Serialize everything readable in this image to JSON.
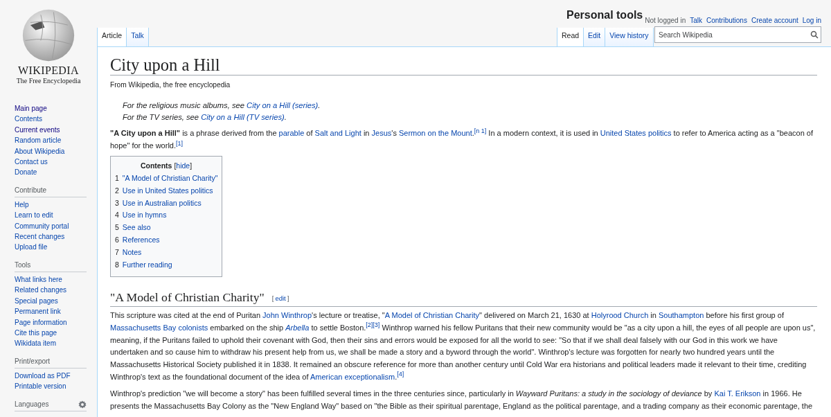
{
  "personal_tools": {
    "heading": "Personal tools",
    "items": [
      {
        "label": "Not logged in",
        "kind": "text"
      },
      {
        "label": "Talk",
        "kind": "link"
      },
      {
        "label": "Contributions",
        "kind": "link"
      },
      {
        "label": "Create account",
        "kind": "link"
      },
      {
        "label": "Log in",
        "kind": "link"
      }
    ]
  },
  "logo": {
    "wordmark": "WIKIPEDIA",
    "tagline": "The Free Encyclopedia"
  },
  "sidebar": {
    "navigation": [
      {
        "label": "Main page",
        "visited": true
      },
      {
        "label": "Contents",
        "visited": false
      },
      {
        "label": "Current events",
        "visited": true
      },
      {
        "label": "Random article",
        "visited": false
      },
      {
        "label": "About Wikipedia",
        "visited": false
      },
      {
        "label": "Contact us",
        "visited": false
      },
      {
        "label": "Donate",
        "visited": false
      }
    ],
    "portals": [
      {
        "heading": "Contribute",
        "items": [
          {
            "label": "Help",
            "visited": false
          },
          {
            "label": "Learn to edit",
            "visited": false
          },
          {
            "label": "Community portal",
            "visited": false
          },
          {
            "label": "Recent changes",
            "visited": false
          },
          {
            "label": "Upload file",
            "visited": false
          }
        ]
      },
      {
        "heading": "Tools",
        "items": [
          {
            "label": "What links here",
            "visited": false
          },
          {
            "label": "Related changes",
            "visited": false
          },
          {
            "label": "Special pages",
            "visited": false
          },
          {
            "label": "Permanent link",
            "visited": false
          },
          {
            "label": "Page information",
            "visited": false
          },
          {
            "label": "Cite this page",
            "visited": false
          },
          {
            "label": "Wikidata item",
            "visited": false
          }
        ]
      },
      {
        "heading": "Print/export",
        "items": [
          {
            "label": "Download as PDF",
            "visited": false
          },
          {
            "label": "Printable version",
            "visited": false
          }
        ]
      },
      {
        "heading": "Languages",
        "kind": "languages"
      }
    ]
  },
  "left_tabs": [
    {
      "label": "Article",
      "selected": true
    },
    {
      "label": "Talk",
      "selected": false
    }
  ],
  "right_tabs": [
    {
      "label": "Read",
      "selected": true
    },
    {
      "label": "Edit",
      "selected": false
    },
    {
      "label": "View history",
      "selected": false
    }
  ],
  "search": {
    "placeholder": "Search Wikipedia"
  },
  "article": {
    "title": "City upon a Hill",
    "subtitle": "From Wikipedia, the free encyclopedia",
    "hatnotes": [
      [
        {
          "kind": "plain",
          "text": "For the religious music albums, see "
        },
        {
          "kind": "link",
          "text": "City on a Hill (series)"
        },
        {
          "kind": "plain",
          "text": "."
        }
      ],
      [
        {
          "kind": "plain",
          "text": "For the TV series, see "
        },
        {
          "kind": "link",
          "text": "City on a Hill (TV series)"
        },
        {
          "kind": "plain",
          "text": "."
        }
      ]
    ],
    "intro": [
      {
        "kind": "plain",
        "text": "**\"A City upon a Hill\"** is a phrase derived from the "
      },
      {
        "kind": "link",
        "text": "parable"
      },
      {
        "kind": "plain",
        "text": " of "
      },
      {
        "kind": "link",
        "text": "Salt and Light"
      },
      {
        "kind": "plain",
        "text": " in "
      },
      {
        "kind": "link",
        "text": "Jesus"
      },
      {
        "kind": "plain",
        "text": "'s "
      },
      {
        "kind": "link",
        "text": "Sermon on the Mount"
      },
      {
        "kind": "plain",
        "text": "."
      },
      {
        "kind": "ref",
        "text": "[n 1]"
      },
      {
        "kind": "plain",
        "text": " In a modern context, it is used in "
      },
      {
        "kind": "link",
        "text": "United States politics"
      },
      {
        "kind": "plain",
        "text": " to refer to America acting as a \"beacon of hope\" for the world."
      },
      {
        "kind": "ref",
        "text": "[1]"
      }
    ],
    "toc": {
      "title": "Contents",
      "toggle": {
        "open": "[",
        "label": "hide",
        "close": "]"
      },
      "items": [
        {
          "number": "1",
          "label": "\"A Model of Christian Charity\""
        },
        {
          "number": "2",
          "label": "Use in United States politics"
        },
        {
          "number": "3",
          "label": "Use in Australian politics"
        },
        {
          "number": "4",
          "label": "Use in hymns"
        },
        {
          "number": "5",
          "label": "See also"
        },
        {
          "number": "6",
          "label": "References"
        },
        {
          "number": "7",
          "label": "Notes"
        },
        {
          "number": "8",
          "label": "Further reading"
        }
      ]
    },
    "sections": [
      {
        "heading": "\"A Model of Christian Charity\"",
        "edit": {
          "open": "[",
          "label": "edit",
          "close": "]"
        },
        "paragraphs": [
          [
            {
              "kind": "plain",
              "text": "This scripture was cited at the end of Puritan "
            },
            {
              "kind": "link",
              "text": "John Winthrop"
            },
            {
              "kind": "plain",
              "text": "'s lecture or treatise, \""
            },
            {
              "kind": "link",
              "text": "A Model of Christian Charity"
            },
            {
              "kind": "plain",
              "text": "\" delivered on March 21, 1630 at "
            },
            {
              "kind": "link",
              "text": "Holyrood Church"
            },
            {
              "kind": "plain",
              "text": " in "
            },
            {
              "kind": "link",
              "text": "Southampton"
            },
            {
              "kind": "plain",
              "text": " before his first group of "
            },
            {
              "kind": "link",
              "text": "Massachusetts Bay colonists"
            },
            {
              "kind": "plain",
              "text": " embarked on the ship "
            },
            {
              "kind": "link",
              "text": "*Arbella*"
            },
            {
              "kind": "plain",
              "text": " to settle Boston."
            },
            {
              "kind": "ref",
              "text": "[2]"
            },
            {
              "kind": "ref",
              "text": "[3]"
            },
            {
              "kind": "plain",
              "text": " Winthrop warned his fellow Puritans that their new community would be \"as a city upon a hill, the eyes of all people are upon us\", meaning, if the Puritans failed to uphold their covenant with God, then their sins and errors would be exposed for all the world to see: \"So that if we shall deal falsely with our God in this work we have undertaken and so cause him to withdraw his present help from us, we shall be made a story and a byword through the world\". Winthrop's lecture was forgotten for nearly two hundred years until the Massachusetts Historical Society published it in 1838. It remained an obscure reference for more than another century until Cold War era historians and political leaders made it relevant to their time, crediting Winthrop's text as the foundational document of the idea of "
            },
            {
              "kind": "link",
              "text": "American exceptionalism"
            },
            {
              "kind": "plain",
              "text": "."
            },
            {
              "kind": "ref",
              "text": "[4]"
            }
          ],
          [
            {
              "kind": "plain",
              "text": "Winthrop's prediction \"we will become a story\" has been fulfilled several times in the three centuries since, particularly in *Wayward Puritans: a study in the sociology of deviance* by "
            },
            {
              "kind": "link",
              "text": "Kai T. Erikson"
            },
            {
              "kind": "plain",
              "text": " in 1966. He presents the Massachusetts Bay Colony as the \"New England Way\" based on \"the Bible as their spiritual parentage, England as the political parentage, and a trading company as their economic parentage, the"
            }
          ]
        ]
      }
    ]
  }
}
